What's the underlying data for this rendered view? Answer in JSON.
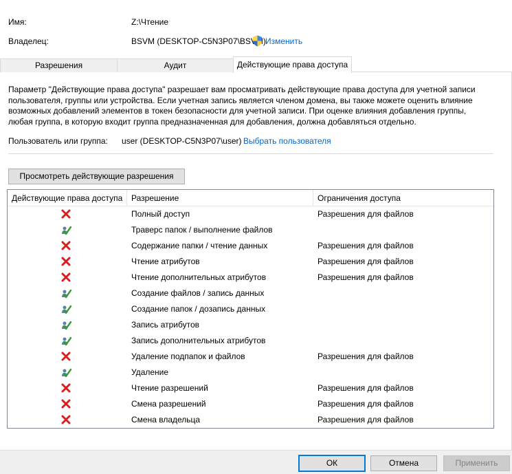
{
  "info": {
    "name_label": "Имя:",
    "name_value": "Z:\\Чтение",
    "owner_label": "Владелец:",
    "owner_value": "BSVM (DESKTOP-C5N3P07\\BSVM)",
    "change_link": "Изменить"
  },
  "tabs": [
    {
      "label": "Разрешения",
      "active": false
    },
    {
      "label": "Аудит",
      "active": false
    },
    {
      "label": "Действующие права доступа",
      "active": true
    }
  ],
  "description": "Параметр \"Действующие права доступа\" разрешает вам просматривать действующие права доступа для учетной записи пользователя, группы или устройства. Если учетная запись является членом домена, вы также можете оценить влияние возможных добавлений элементов в токен безопасности для учетной записи. При оценке влияния добавления группы, любая группа, в которую входит группа предназначенная для добавления, должна добавляться отдельно.",
  "user": {
    "label": "Пользователь или группа:",
    "value": "user (DESKTOP-C5N3P07\\user)",
    "select_link": "Выбрать пользователя"
  },
  "view_button": "Просмотреть действующие разрешения",
  "table": {
    "headers": [
      "Действующие права доступа",
      "Разрешение",
      "Ограничения доступа"
    ],
    "rows": [
      {
        "allowed": false,
        "permission": "Полный доступ",
        "limit": "Разрешения для файлов"
      },
      {
        "allowed": true,
        "permission": "Траверс папок / выполнение файлов",
        "limit": ""
      },
      {
        "allowed": false,
        "permission": "Содержание папки / чтение данных",
        "limit": "Разрешения для файлов"
      },
      {
        "allowed": false,
        "permission": "Чтение атрибутов",
        "limit": "Разрешения для файлов"
      },
      {
        "allowed": false,
        "permission": "Чтение дополнительных атрибутов",
        "limit": "Разрешения для файлов"
      },
      {
        "allowed": true,
        "permission": "Создание файлов / запись данных",
        "limit": ""
      },
      {
        "allowed": true,
        "permission": "Создание папок / дозапись данных",
        "limit": ""
      },
      {
        "allowed": true,
        "permission": "Запись атрибутов",
        "limit": ""
      },
      {
        "allowed": true,
        "permission": "Запись дополнительных атрибутов",
        "limit": ""
      },
      {
        "allowed": false,
        "permission": "Удаление подпапок и файлов",
        "limit": "Разрешения для файлов"
      },
      {
        "allowed": true,
        "permission": "Удаление",
        "limit": ""
      },
      {
        "allowed": false,
        "permission": "Чтение разрешений",
        "limit": "Разрешения для файлов"
      },
      {
        "allowed": false,
        "permission": "Смена разрешений",
        "limit": "Разрешения для файлов"
      },
      {
        "allowed": false,
        "permission": "Смена владельца",
        "limit": "Разрешения для файлов"
      }
    ]
  },
  "buttons": {
    "ok": "ОК",
    "cancel": "Отмена",
    "apply": "Применить"
  },
  "colors": {
    "link": "#0066cc",
    "deny": "#d91e1e",
    "allow": "#3a9a3a",
    "accent_border": "#0078d7"
  }
}
